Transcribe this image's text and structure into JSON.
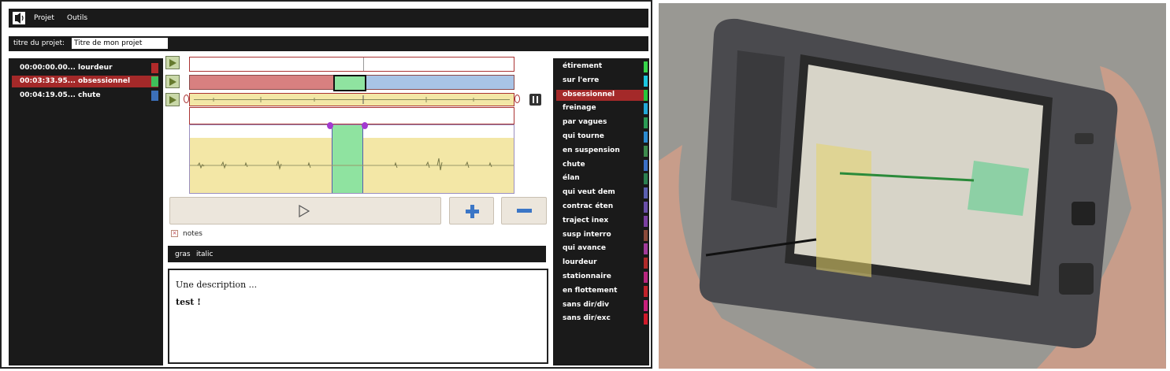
{
  "menu": {
    "items": [
      "Projet",
      "Outils"
    ]
  },
  "project": {
    "title_label": "titre du projet:",
    "title_value": "Titre de mon projet"
  },
  "segments": [
    {
      "time": "00:00:00.00...",
      "label": "lourdeur",
      "color": "#b22a2a",
      "selected": false
    },
    {
      "time": "00:03:33.95...",
      "label": "obsessionnel",
      "color": "#3fbf5a",
      "selected": true
    },
    {
      "time": "00:04:19.05...",
      "label": "chute",
      "color": "#3c6fb8",
      "selected": false
    }
  ],
  "moods": [
    {
      "label": "étirement",
      "color": "#37d44a"
    },
    {
      "label": "sur l'erre",
      "color": "#1bc6e0"
    },
    {
      "label": "obsessionnel",
      "color": "#27c63a",
      "selected": true
    },
    {
      "label": "freinage",
      "color": "#21a8d8"
    },
    {
      "label": "par vagues",
      "color": "#2a9a55"
    },
    {
      "label": "qui tourne",
      "color": "#2a8ad0"
    },
    {
      "label": "en suspension",
      "color": "#3c8a4c"
    },
    {
      "label": "chute",
      "color": "#3a6fc6"
    },
    {
      "label": "élan",
      "color": "#2a7f50"
    },
    {
      "label": "qui veut dem",
      "color": "#5a5fb0"
    },
    {
      "label": "contrac éten",
      "color": "#6a4fa8"
    },
    {
      "label": "traject inex",
      "color": "#7a3fa0"
    },
    {
      "label": "susp interro",
      "color": "#8a4a3a"
    },
    {
      "label": "qui avance",
      "color": "#a23a9a"
    },
    {
      "label": "lourdeur",
      "color": "#b02a2a"
    },
    {
      "label": "stationnaire",
      "color": "#b8267f"
    },
    {
      "label": "en flottement",
      "color": "#c0222a"
    },
    {
      "label": "sans dir/div",
      "color": "#c81f7a"
    },
    {
      "label": "sans dir/exc",
      "color": "#d01a2a"
    }
  ],
  "notes_label": "notes",
  "format": {
    "bold": "gras",
    "italic": "italic"
  },
  "editor": {
    "line1": "Une description ...",
    "line2": "test !"
  },
  "colors": {
    "panel": "#1a1a1a",
    "selected": "#a42929",
    "track_red": "#d88080",
    "track_blue": "#a8c4e6",
    "track_yellow": "#f3e7a6",
    "selection_green": "#8fe3a0"
  }
}
